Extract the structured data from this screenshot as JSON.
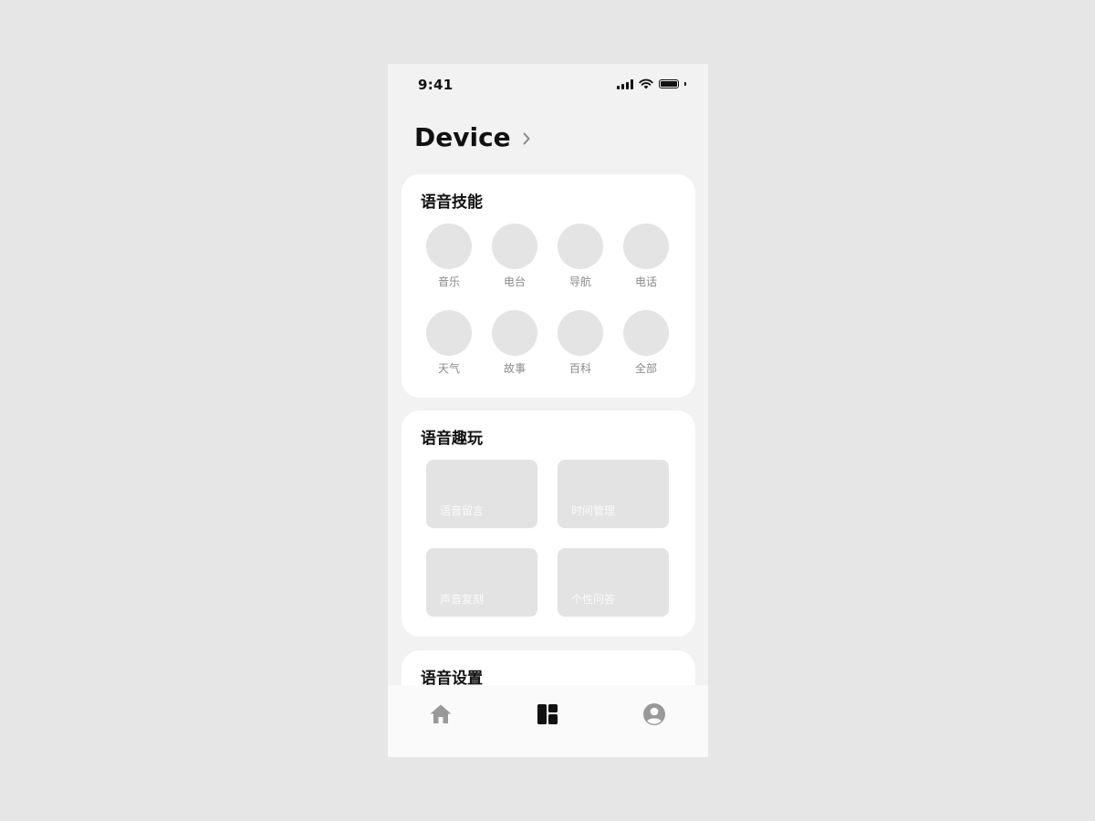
{
  "status_bar": {
    "time": "9:41"
  },
  "header": {
    "title": "Device"
  },
  "skills_section": {
    "title": "语音技能",
    "items": [
      {
        "label": "音乐"
      },
      {
        "label": "电台"
      },
      {
        "label": "导航"
      },
      {
        "label": "电话"
      },
      {
        "label": "天气"
      },
      {
        "label": "故事"
      },
      {
        "label": "百科"
      },
      {
        "label": "全部"
      }
    ]
  },
  "fun_section": {
    "title": "语音趣玩",
    "tiles": [
      {
        "label": "语音留言"
      },
      {
        "label": "时间管理"
      },
      {
        "label": "声音复刻"
      },
      {
        "label": "个性问答"
      }
    ]
  },
  "settings_section": {
    "title": "语音设置"
  },
  "tab_bar": {
    "tabs": [
      {
        "icon": "home-icon",
        "active": false
      },
      {
        "icon": "dashboard-icon",
        "active": true
      },
      {
        "icon": "account-icon",
        "active": false
      }
    ],
    "active_color": "#111111",
    "inactive_color": "#999999"
  }
}
